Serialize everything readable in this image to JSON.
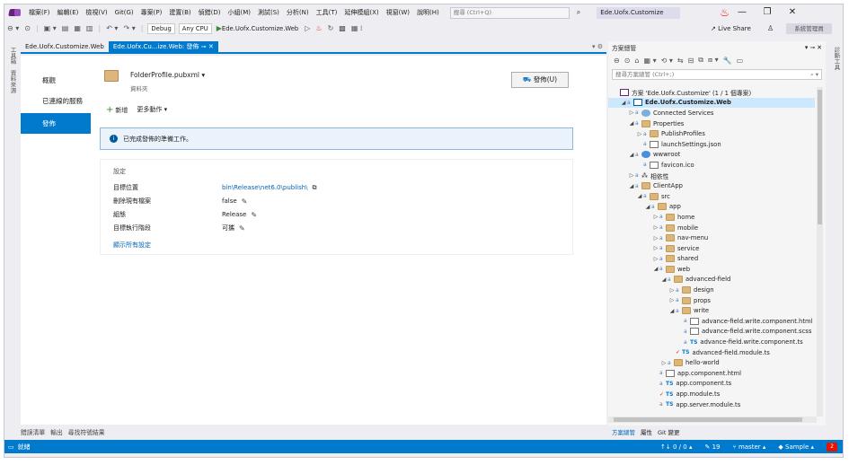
{
  "menu": [
    "檔案(F)",
    "編輯(E)",
    "檢視(V)",
    "Git(G)",
    "專案(P)",
    "建置(B)",
    "偵錯(D)",
    "小組(M)",
    "測試(S)",
    "分析(N)",
    "工具(T)",
    "延伸模組(X)",
    "視窗(W)",
    "說明(H)"
  ],
  "search": {
    "placeholder": "搜尋 (Ctrl+Q)"
  },
  "window_title": "Ede.Uofx.Customize",
  "toolbar": {
    "config": "Debug",
    "platform": "Any CPU",
    "run_target": "Ede.Uofx.Customize.Web",
    "live_share": "Live Share",
    "admin": "系統管理員"
  },
  "left_tabs": [
    "工具箱",
    "資料來源"
  ],
  "right_tabs": [
    "診斷工具"
  ],
  "doc_tabs": [
    {
      "label": "Ede.Uofx.Customize.Web"
    },
    {
      "label": "Ede.Uofx.Cu...ize.Web: 發佈"
    }
  ],
  "sidenav": [
    "概觀",
    "已連線的服務",
    "發佈"
  ],
  "publish": {
    "profile_name": "FolderProfile.pubxml",
    "profile_type": "資料夾",
    "publish_button": "發佈(U)",
    "new_label": "新增",
    "more_actions": "更多動作",
    "info_message": "已完成發佈的準備工作。",
    "settings_title": "設定",
    "settings": [
      {
        "label": "目標位置",
        "value": "bin\\Release\\net6.0\\publish\\"
      },
      {
        "label": "刪除現有檔案",
        "value": "false"
      },
      {
        "label": "組態",
        "value": "Release"
      },
      {
        "label": "目標執行階段",
        "value": "可攜"
      }
    ],
    "show_all": "顯示所有設定"
  },
  "bottom_tabs": [
    "錯誤清單",
    "輸出",
    "尋找符號結果"
  ],
  "solution_explorer": {
    "title": "方案總管",
    "search_placeholder": "搜尋方案總管 (Ctrl+;)",
    "items": [
      {
        "label": "方案 'Ede.Uofx.Customize' (1 / 1 個專案)",
        "depth": 0,
        "arrow": "",
        "icon": "sln"
      },
      {
        "label": "Ede.Uofx.Customize.Web",
        "depth": 1,
        "arrow": "◢",
        "icon": "web",
        "selected": true
      },
      {
        "label": "Connected Services",
        "depth": 2,
        "arrow": "▷",
        "icon": "conn"
      },
      {
        "label": "Properties",
        "depth": 2,
        "arrow": "◢",
        "icon": "folder"
      },
      {
        "label": "PublishProfiles",
        "depth": 3,
        "arrow": "▷",
        "icon": "folder"
      },
      {
        "label": "launchSettings.json",
        "depth": 3,
        "arrow": "",
        "icon": "file"
      },
      {
        "label": "wwwroot",
        "depth": 2,
        "arrow": "◢",
        "icon": "globe"
      },
      {
        "label": "favicon.ico",
        "depth": 3,
        "arrow": "",
        "icon": "file"
      },
      {
        "label": "相依性",
        "depth": 2,
        "arrow": "▷",
        "icon": "dep"
      },
      {
        "label": "ClientApp",
        "depth": 2,
        "arrow": "◢",
        "icon": "folder"
      },
      {
        "label": "src",
        "depth": 3,
        "arrow": "◢",
        "icon": "folder"
      },
      {
        "label": "app",
        "depth": 4,
        "arrow": "◢",
        "icon": "folder"
      },
      {
        "label": "home",
        "depth": 5,
        "arrow": "▷",
        "icon": "folder"
      },
      {
        "label": "mobile",
        "depth": 5,
        "arrow": "▷",
        "icon": "folder"
      },
      {
        "label": "nav-menu",
        "depth": 5,
        "arrow": "▷",
        "icon": "folder"
      },
      {
        "label": "service",
        "depth": 5,
        "arrow": "▷",
        "icon": "folder"
      },
      {
        "label": "shared",
        "depth": 5,
        "arrow": "▷",
        "icon": "folder"
      },
      {
        "label": "web",
        "depth": 5,
        "arrow": "◢",
        "icon": "folder"
      },
      {
        "label": "advanced-field",
        "depth": 6,
        "arrow": "◢",
        "icon": "folder"
      },
      {
        "label": "design",
        "depth": 7,
        "arrow": "▷",
        "icon": "folder"
      },
      {
        "label": "props",
        "depth": 7,
        "arrow": "▷",
        "icon": "folder"
      },
      {
        "label": "write",
        "depth": 7,
        "arrow": "◢",
        "icon": "folder"
      },
      {
        "label": "advance-field.write.component.html",
        "depth": 8,
        "arrow": "",
        "icon": "file"
      },
      {
        "label": "advance-field.write.component.scss",
        "depth": 8,
        "arrow": "",
        "icon": "file"
      },
      {
        "label": "advance-field.write.component.ts",
        "depth": 8,
        "arrow": "",
        "icon": "ts"
      },
      {
        "label": "advanced-field.module.ts",
        "depth": 7,
        "arrow": "",
        "icon": "ts",
        "check": true
      },
      {
        "label": "hello-world",
        "depth": 6,
        "arrow": "▷",
        "icon": "folder"
      },
      {
        "label": "app.component.html",
        "depth": 5,
        "arrow": "",
        "icon": "file"
      },
      {
        "label": "app.component.ts",
        "depth": 5,
        "arrow": "",
        "icon": "ts"
      },
      {
        "label": "app.module.ts",
        "depth": 5,
        "arrow": "",
        "icon": "ts",
        "check": true
      },
      {
        "label": "app.server.module.ts",
        "depth": 5,
        "arrow": "",
        "icon": "ts"
      }
    ],
    "bottom_tabs": [
      "方案總管",
      "屬性",
      "Git 變更"
    ]
  },
  "status": {
    "ready": "就緒",
    "changes": "↑↓ 0 / 0 ▴",
    "edits": "19",
    "branch": "master ▴",
    "repo": "Sample ▴",
    "notifications": "2"
  }
}
